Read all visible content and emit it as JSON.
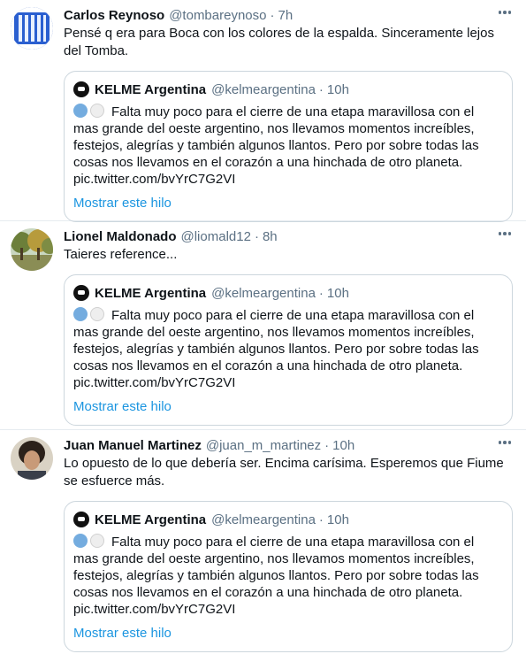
{
  "tweets": [
    {
      "name": "Carlos Reynoso",
      "handle": "@tombareynoso",
      "dot": "·",
      "time": "7h",
      "text": "Pensé q era para Boca con los colores de la espalda. Sinceramente lejos del Tomba.",
      "avatar_icon": "striped-blue-avatar"
    },
    {
      "name": "Lionel Maldonado",
      "handle": "@liomald12",
      "dot": "·",
      "time": "8h",
      "text": "Taieres reference...",
      "avatar_icon": "trees-photo-avatar"
    },
    {
      "name": "Juan Manuel Martinez",
      "handle": "@juan_m_martinez",
      "dot": "·",
      "time": "10h",
      "text": "Lo opuesto de lo que debería ser. Encima carísima. Esperemos que Fiume se esfuerce más.",
      "avatar_icon": "person-photo-avatar"
    }
  ],
  "quote": {
    "name": "KELME Argentina",
    "handle": "@kelmeargentina",
    "dot": "·",
    "time": "10h",
    "text": "Falta muy poco para el cierre de una etapa maravillosa con el mas grande del oeste argentino, nos llevamos momentos increíbles, festejos, alegrías y también algunos llantos. Pero por sobre todas las cosas nos llevamos en el corazón a una hinchada de otro planeta.",
    "link": "pic.twitter.com/bvYrC7G2VI",
    "show_thread": "Mostrar este hilo"
  },
  "colors": {
    "link_blue": "#1b95e0",
    "secondary_text": "#5b7083",
    "border": "#ccd6dd"
  }
}
